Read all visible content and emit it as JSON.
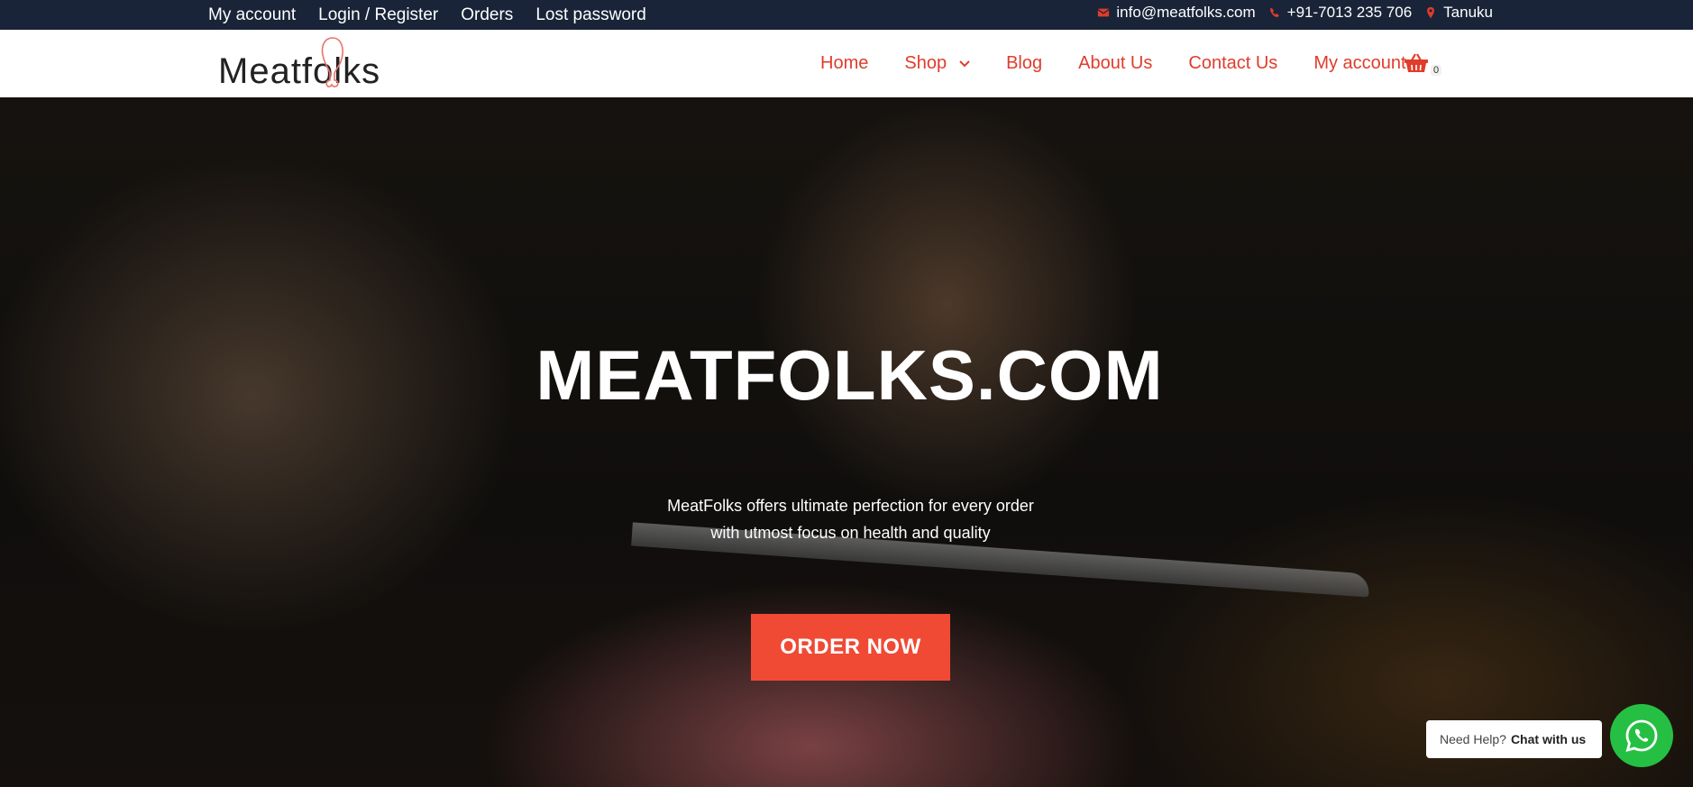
{
  "topbar": {
    "links": [
      "My account",
      "Login / Register",
      "Orders",
      "Lost password"
    ],
    "email": "info@meatfolks.com",
    "phone": "+91-7013 235 706",
    "location": "Tanuku"
  },
  "header": {
    "logo_text": "Meatfolks",
    "nav": [
      "Home",
      "Shop",
      "Blog",
      "About Us",
      "Contact Us",
      "My account"
    ],
    "cart_count": "0"
  },
  "hero": {
    "title": "MEATFOLKS.COM",
    "subtitle_line1": "MeatFolks offers ultimate perfection for every order",
    "subtitle_line2": "with utmost focus on health and quality",
    "cta": "ORDER NOW"
  },
  "whatsapp": {
    "prompt": "Need Help?",
    "action": "Chat with us"
  },
  "colors": {
    "topbar_bg": "#1a2438",
    "accent": "#e03c2b",
    "cta_bg": "#f04a35",
    "whatsapp": "#25c043"
  }
}
